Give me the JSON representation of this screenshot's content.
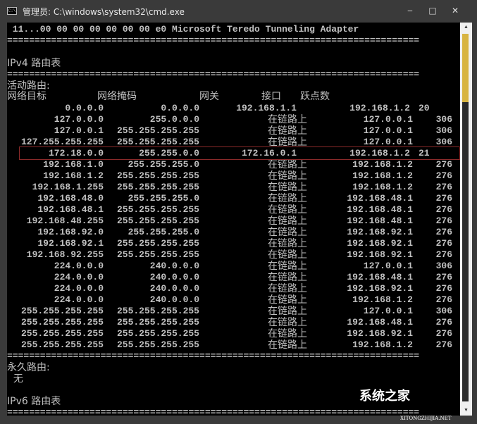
{
  "window": {
    "title": "管理员: C:\\windows\\system32\\cmd.exe",
    "icon": "C:\\",
    "minimize": "‒",
    "maximize": "□",
    "close": "✕"
  },
  "console": {
    "top_line": " 11...00 00 00 00 00 00 00 e0 Microsoft Teredo Tunneling Adapter",
    "separator": "===========================================================================",
    "ipv4_title": "IPv4 路由表",
    "active_routes": "活动路由:",
    "headers": {
      "dest": "网络目标",
      "mask": "网络掩码",
      "gateway": "网关",
      "iface": "接口",
      "metric": "跃点数"
    },
    "routes": [
      [
        "0.0.0.0",
        "0.0.0.0",
        "192.168.1.1",
        "192.168.1.2",
        "20"
      ],
      [
        "127.0.0.0",
        "255.0.0.0",
        "在链路上",
        "127.0.0.1",
        "306"
      ],
      [
        "127.0.0.1",
        "255.255.255.255",
        "在链路上",
        "127.0.0.1",
        "306"
      ],
      [
        "127.255.255.255",
        "255.255.255.255",
        "在链路上",
        "127.0.0.1",
        "306"
      ],
      [
        "172.18.0.0",
        "255.255.0.0",
        "172.16.0.1",
        "192.168.1.2",
        "21"
      ],
      [
        "192.168.1.0",
        "255.255.255.0",
        "在链路上",
        "192.168.1.2",
        "276"
      ],
      [
        "192.168.1.2",
        "255.255.255.255",
        "在链路上",
        "192.168.1.2",
        "276"
      ],
      [
        "192.168.1.255",
        "255.255.255.255",
        "在链路上",
        "192.168.1.2",
        "276"
      ],
      [
        "192.168.48.0",
        "255.255.255.0",
        "在链路上",
        "192.168.48.1",
        "276"
      ],
      [
        "192.168.48.1",
        "255.255.255.255",
        "在链路上",
        "192.168.48.1",
        "276"
      ],
      [
        "192.168.48.255",
        "255.255.255.255",
        "在链路上",
        "192.168.48.1",
        "276"
      ],
      [
        "192.168.92.0",
        "255.255.255.0",
        "在链路上",
        "192.168.92.1",
        "276"
      ],
      [
        "192.168.92.1",
        "255.255.255.255",
        "在链路上",
        "192.168.92.1",
        "276"
      ],
      [
        "192.168.92.255",
        "255.255.255.255",
        "在链路上",
        "192.168.92.1",
        "276"
      ],
      [
        "224.0.0.0",
        "240.0.0.0",
        "在链路上",
        "127.0.0.1",
        "306"
      ],
      [
        "224.0.0.0",
        "240.0.0.0",
        "在链路上",
        "192.168.48.1",
        "276"
      ],
      [
        "224.0.0.0",
        "240.0.0.0",
        "在链路上",
        "192.168.92.1",
        "276"
      ],
      [
        "224.0.0.0",
        "240.0.0.0",
        "在链路上",
        "192.168.1.2",
        "276"
      ],
      [
        "255.255.255.255",
        "255.255.255.255",
        "在链路上",
        "127.0.0.1",
        "306"
      ],
      [
        "255.255.255.255",
        "255.255.255.255",
        "在链路上",
        "192.168.48.1",
        "276"
      ],
      [
        "255.255.255.255",
        "255.255.255.255",
        "在链路上",
        "192.168.92.1",
        "276"
      ],
      [
        "255.255.255.255",
        "255.255.255.255",
        "在链路上",
        "192.168.1.2",
        "276"
      ]
    ],
    "highlighted_route": 4,
    "persistent_routes": "永久路由:",
    "none": "  无",
    "ipv6_title": "IPv6 路由表"
  },
  "watermark": {
    "text": "系统之家",
    "sub": "XITONGZHIJIA.NET"
  },
  "colors": {
    "highlight": "#8b2a2a",
    "scroll_thumb": "#d8b440"
  }
}
